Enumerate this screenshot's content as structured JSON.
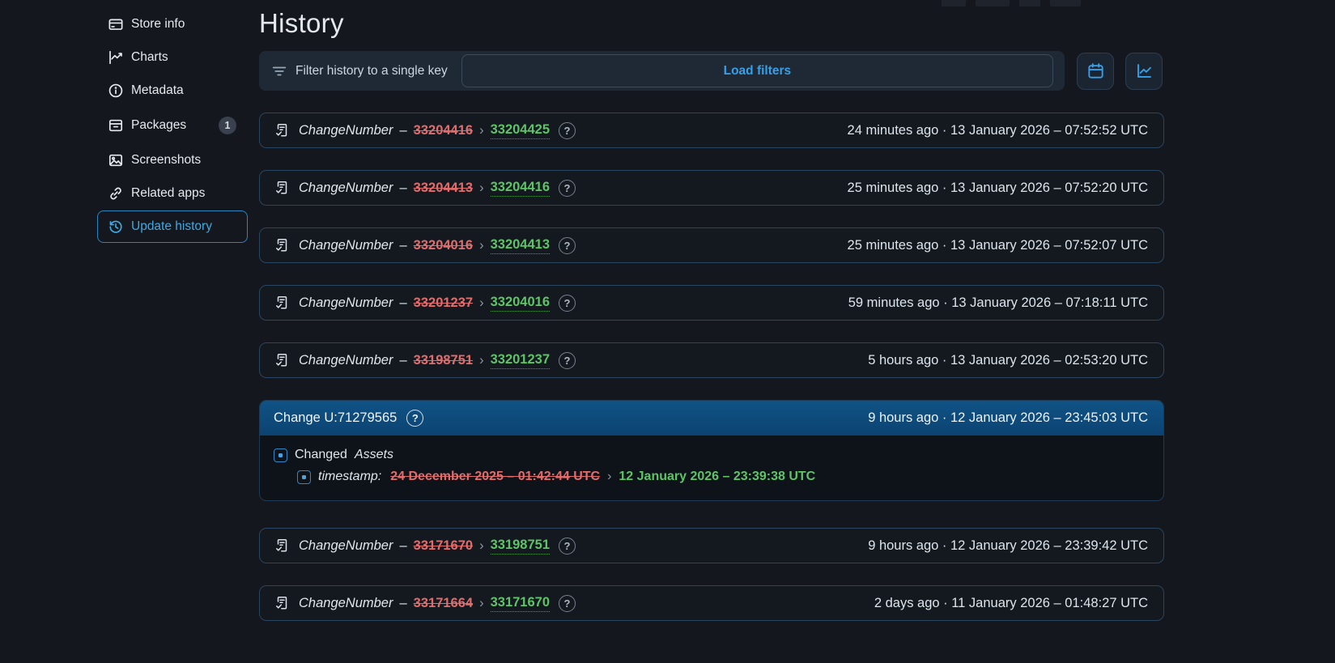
{
  "page": {
    "title": "History"
  },
  "sidebar": {
    "items": [
      {
        "label": "Store info",
        "icon": "storefront-icon",
        "active": false
      },
      {
        "label": "Charts",
        "icon": "chart-icon",
        "active": false
      },
      {
        "label": "Metadata",
        "icon": "info-icon",
        "active": false
      },
      {
        "label": "Packages",
        "icon": "package-icon",
        "active": false,
        "badge": "1"
      },
      {
        "label": "Screenshots",
        "icon": "image-icon",
        "active": false
      },
      {
        "label": "Related apps",
        "icon": "link-icon",
        "active": false
      },
      {
        "label": "Update history",
        "icon": "history-icon",
        "active": true
      }
    ]
  },
  "toolbar": {
    "filter_label": "Filter history to a single key",
    "load_filters_label": "Load filters"
  },
  "labels": {
    "dash": "–",
    "arrow": "›"
  },
  "icons": {
    "help": "?"
  },
  "entries": [
    {
      "key": "ChangeNumber",
      "old": "33204416",
      "new": "33204425",
      "when": "24 minutes ago · 13 January 2026 – 07:52:52 UTC"
    },
    {
      "key": "ChangeNumber",
      "old": "33204413",
      "new": "33204416",
      "when": "25 minutes ago · 13 January 2026 – 07:52:20 UTC"
    },
    {
      "key": "ChangeNumber",
      "old": "33204016",
      "new": "33204413",
      "when": "25 minutes ago · 13 January 2026 – 07:52:07 UTC"
    },
    {
      "key": "ChangeNumber",
      "old": "33201237",
      "new": "33204016",
      "when": "59 minutes ago · 13 January 2026 – 07:18:11 UTC"
    },
    {
      "key": "ChangeNumber",
      "old": "33198751",
      "new": "33201237",
      "when": "5 hours ago · 13 January 2026 – 02:53:20 UTC"
    },
    {
      "key": "ChangeNumber",
      "old": "33171670",
      "new": "33198751",
      "when": "9 hours ago · 12 January 2026 – 23:39:42 UTC"
    },
    {
      "key": "ChangeNumber",
      "old": "33171664",
      "new": "33171670",
      "when": "2 days ago · 11 January 2026 – 01:48:27 UTC"
    }
  ],
  "expanded": {
    "title": "Change U:71279565",
    "when": "9 hours ago · 12 January 2026 – 23:45:03 UTC",
    "changed_label": "Changed",
    "changed_key": "Assets",
    "sub_key": "timestamp:",
    "old": "24 December 2025 – 01:42:44 UTC",
    "new": "12 January 2026 – 23:39:38 UTC"
  },
  "colors": {
    "background": "#14171d",
    "accent_blue": "#35a0ea",
    "old_red": "#e06c6c",
    "new_green": "#5ec467",
    "expanded_header_blue": "#0e4f80"
  }
}
